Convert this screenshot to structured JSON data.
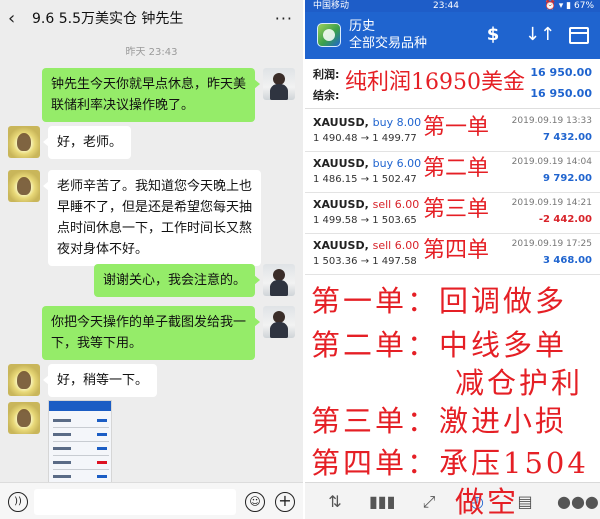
{
  "chat": {
    "header": {
      "back_glyph": "‹",
      "title": "9.6  5.5万美实仓  钟先生",
      "more_glyph": "···"
    },
    "timestamp": "昨天 23:43",
    "messages": [
      {
        "side": "right",
        "lines": [
          "钟先生今天你就早点休息，昨天美",
          "联储利率决议操作晚了。"
        ]
      },
      {
        "side": "left",
        "lines": [
          "好，老师。"
        ]
      },
      {
        "side": "left",
        "lines": [
          "老师辛苦了。我知道您今天晚上也",
          "早睡不了，但是还是希望您每天抽",
          "点时间休息一下，工作时间长又熬",
          "夜对身体不好。"
        ]
      },
      {
        "side": "right",
        "lines": [
          "谢谢关心，我会注意的。"
        ]
      },
      {
        "side": "right",
        "lines": [
          "你把今天操作的单子截图发给我一",
          "下，我等下用。"
        ]
      },
      {
        "side": "left",
        "lines": [
          "好，稍等一下。"
        ]
      }
    ],
    "input_bar": {
      "voice_icon": "voice-icon",
      "emoji_icon": "emoji-icon",
      "plus_icon": "plus-icon",
      "voice_glyph": "))",
      "emoji_glyph": "☺",
      "plus_glyph": "+"
    }
  },
  "app": {
    "status": {
      "carrier": "中国移动",
      "time": "23:44",
      "icons": "⏰ ▾ ▮ 67%"
    },
    "header": {
      "title": "历史",
      "subtitle": "全部交易品种",
      "dollar_glyph": "$",
      "sort_glyph": "↓↑"
    },
    "summary": {
      "profit_label": "利润:",
      "profit_value": "16 950.00",
      "balance_label": "结余:",
      "balance_value": "16 950.00"
    },
    "trades": [
      {
        "symbol": "XAUUSD,",
        "side": "buy 8.00",
        "side_type": "buy",
        "prices": "1 490.48 → 1 499.77",
        "date": "2019.09.19 13:33",
        "profit": "7 432.00",
        "sign": "pos"
      },
      {
        "symbol": "XAUUSD,",
        "side": "buy 6.00",
        "side_type": "buy",
        "prices": "1 486.15 → 1 502.47",
        "date": "2019.09.19 14:04",
        "profit": "9 792.00",
        "sign": "pos"
      },
      {
        "symbol": "XAUUSD,",
        "side": "sell 6.00",
        "side_type": "sell",
        "prices": "1 499.58 → 1 503.65",
        "date": "2019.09.19 14:21",
        "profit": "-2 442.00",
        "sign": "neg"
      },
      {
        "symbol": "XAUUSD,",
        "side": "sell 6.00",
        "side_type": "sell",
        "prices": "1 503.36 → 1 497.58",
        "date": "2019.09.19 17:25",
        "profit": "3 468.00",
        "sign": "pos"
      }
    ],
    "overlays": {
      "net_profit": "纯利润16950美金",
      "order1": "第一单",
      "order2": "第二单",
      "order3": "第三单",
      "order4": "第四单",
      "note1": "第一单：回调做多",
      "note2a": "第二单：中线多单",
      "note2b": "减仓护利",
      "note3": "第三单：激进小损",
      "note4a": "第四单：承压1504",
      "note4b": "做空"
    },
    "nav": {
      "items": [
        "quotes-icon",
        "chart-icon",
        "trade-icon",
        "history-icon",
        "news-icon",
        "messages-icon"
      ]
    }
  },
  "colors": {
    "wechat_green": "#95ec69",
    "mt_blue": "#1f64cf",
    "overlay_red": "#e51f25"
  }
}
